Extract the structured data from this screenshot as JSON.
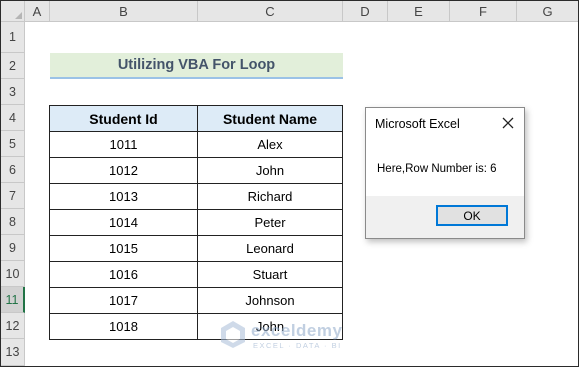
{
  "columns": [
    "A",
    "B",
    "C",
    "D",
    "E",
    "F",
    "G"
  ],
  "rows": [
    "1",
    "2",
    "3",
    "4",
    "5",
    "6",
    "7",
    "8",
    "9",
    "10",
    "11",
    "12",
    "13"
  ],
  "selected_row": "11",
  "sheet_title": "Utilizing VBA For Loop",
  "table": {
    "headers": [
      "Student Id",
      "Student Name"
    ],
    "rows": [
      [
        "1011",
        "Alex"
      ],
      [
        "1012",
        "John"
      ],
      [
        "1013",
        "Richard"
      ],
      [
        "1014",
        "Peter"
      ],
      [
        "1015",
        "Leonard"
      ],
      [
        "1016",
        "Stuart"
      ],
      [
        "1017",
        "Johnson"
      ],
      [
        "1018",
        "John"
      ]
    ]
  },
  "dialog": {
    "title": "Microsoft Excel",
    "message": "Here,Row Number is: 6",
    "ok_label": "OK",
    "close_icon": "close-icon"
  },
  "watermark": {
    "name": "exceldemy",
    "tagline": "EXCEL · DATA · BI"
  },
  "colors": {
    "title_fill": "#e2efda",
    "header_fill": "#ddebf7",
    "title_text": "#44546a",
    "accent": "#217346",
    "button_border": "#0078d7"
  }
}
